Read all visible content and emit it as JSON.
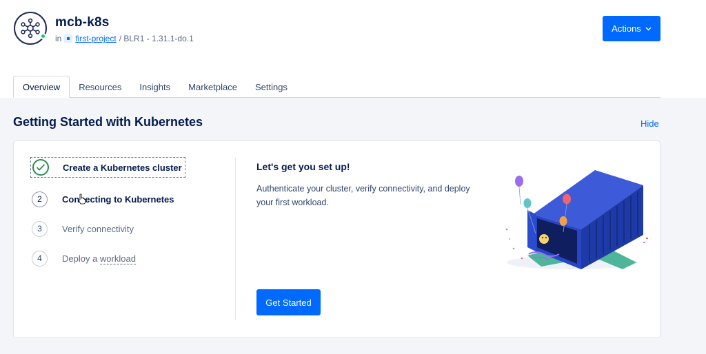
{
  "header": {
    "cluster_name": "mcb-k8s",
    "in_label": "in",
    "project_link": "first-project",
    "region_version": "/ BLR1 - 1.31.1-do.1",
    "actions_label": "Actions"
  },
  "tabs": [
    {
      "label": "Overview",
      "active": true
    },
    {
      "label": "Resources"
    },
    {
      "label": "Insights"
    },
    {
      "label": "Marketplace"
    },
    {
      "label": "Settings"
    }
  ],
  "getting_started": {
    "title": "Getting Started with Kubernetes",
    "hide_label": "Hide",
    "steps": [
      {
        "number": "",
        "label": "Create a Kubernetes cluster",
        "status": "done"
      },
      {
        "number": "2",
        "label": "Connecting to Kubernetes",
        "status": "current"
      },
      {
        "number": "3",
        "label": "Verify connectivity",
        "status": "pending"
      },
      {
        "number": "4",
        "label_prefix": "Deploy a ",
        "label_link": "workload",
        "status": "pending"
      }
    ],
    "setup_title": "Let's get you set up!",
    "setup_description": "Authenticate your cluster, verify connectivity, and deploy your first workload.",
    "cta_label": "Get Started"
  },
  "colors": {
    "primary": "#0069ff",
    "success": "#2a8d4f",
    "status_online": "#15cd72",
    "text_dark": "#031b4e"
  },
  "icons": {
    "cluster": "kubernetes-cluster-icon",
    "done_step": "checkmark-icon",
    "actions": "chevron-down-icon"
  }
}
